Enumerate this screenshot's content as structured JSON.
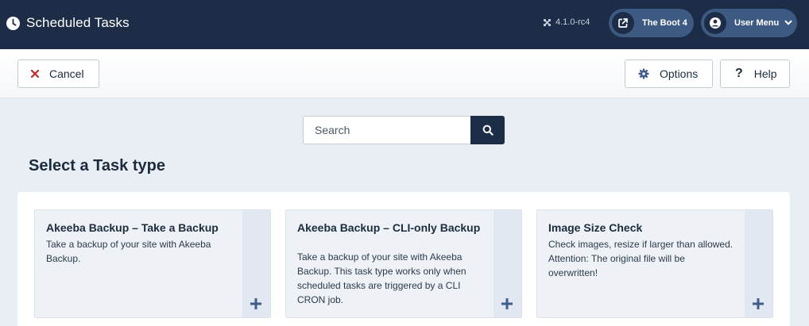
{
  "header": {
    "title": "Scheduled Tasks",
    "version": "4.1.0-rc4",
    "site_label": "The Boot 4",
    "user_menu_label": "User Menu"
  },
  "toolbar": {
    "cancel_label": "Cancel",
    "options_label": "Options",
    "help_label": "Help"
  },
  "search": {
    "placeholder": "Search"
  },
  "section_title": "Select a Task type",
  "cards": [
    {
      "title": "Akeeba Backup – Take a Backup",
      "description": "Take a backup of your site with Akeeba Backup."
    },
    {
      "title": "Akeeba Backup – CLI-only Backup",
      "description": "Take a backup of your site with Akeeba Backup. This task type works only when scheduled tasks are triggered by a CLI CRON job."
    },
    {
      "title": "Image Size Check",
      "description": "Check images, resize if larger than allowed. Attention: The original file will be overwritten!"
    }
  ],
  "colors": {
    "header_bg": "#1e2d47",
    "pill_bg": "#3c5a82",
    "page_bg": "#e9eef4",
    "cancel_x": "#c52827",
    "options_gear": "#3f5e8c",
    "plus": "#3f5e8c"
  }
}
